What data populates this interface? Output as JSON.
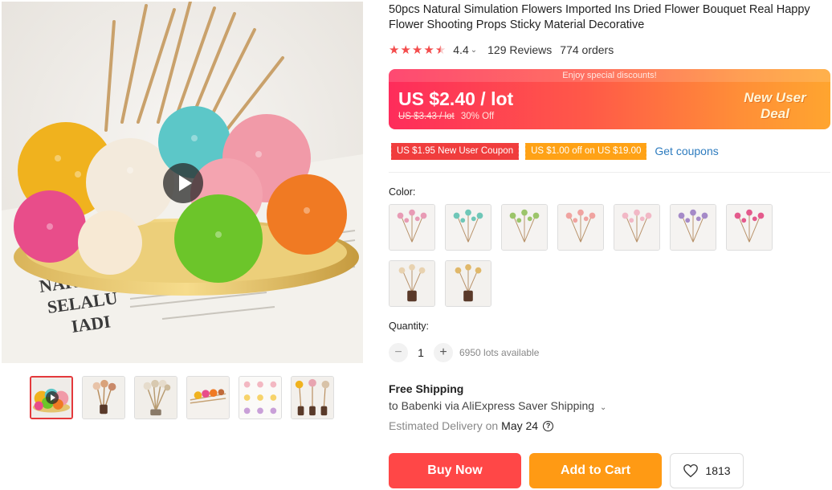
{
  "product": {
    "title": "50pcs Natural Simulation Flowers Imported Ins Dried Flower Bouquet Real Happy Flower Shooting Props Sticky Material Decorative",
    "main_image_text": [
      "NAKA",
      "SELALU",
      "IADI"
    ]
  },
  "rating": {
    "value": "4.4",
    "stars": 4.4,
    "reviews": "129 Reviews",
    "orders": "774 orders"
  },
  "price": {
    "banner": "Enjoy special discounts!",
    "current": "US $2.40 / lot",
    "original": "US $3.43 / lot",
    "discount": "30% Off",
    "deal_line1": "New User",
    "deal_line2": "Deal"
  },
  "coupons": {
    "items": [
      "US $1.95 New User Coupon",
      "US $1.00 off on US $19.00"
    ],
    "link": "Get coupons"
  },
  "color": {
    "label": "Color:",
    "options_count": 9
  },
  "quantity": {
    "label": "Quantity:",
    "value": "1",
    "minus": "−",
    "plus": "+",
    "available": "6950 lots available"
  },
  "shipping": {
    "title": "Free Shipping",
    "to": "to Babenki via AliExpress Saver Shipping",
    "eta_label": "Estimated Delivery on",
    "eta_date": "May 24"
  },
  "actions": {
    "buy_now": "Buy Now",
    "add_to_cart": "Add to Cart",
    "wishlist_count": "1813"
  },
  "colors": {
    "accent_red": "#ff4747",
    "accent_orange": "#ff9a14",
    "star": "#f44c4c",
    "link": "#2e7cbf"
  }
}
